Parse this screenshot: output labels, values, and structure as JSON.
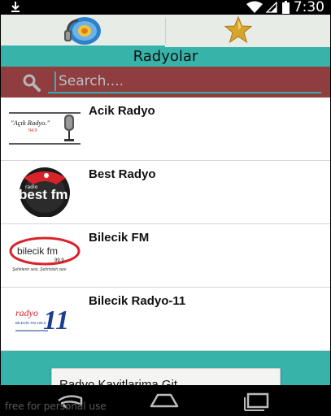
{
  "status_bar": {
    "time": "7:30"
  },
  "tabs": [
    {
      "icon": "radio-speaker-icon",
      "selected": true
    },
    {
      "icon": "star-icon",
      "selected": false
    }
  ],
  "title": "Radyolar",
  "search": {
    "placeholder": "Search....",
    "value": ""
  },
  "stations": [
    {
      "name": "Acik Radyo",
      "logo": "acik-radyo-logo",
      "logo_text": "\"Açık Radyo.\"",
      "logo_freq": "94.9"
    },
    {
      "name": "Best Radyo",
      "logo": "best-fm-logo",
      "logo_small": "radio",
      "logo_text": "best fm"
    },
    {
      "name": "Bilecik FM",
      "logo": "bilecik-fm-logo",
      "logo_text": "bilecik fm",
      "logo_freq": "99.9",
      "logo_slogan": "Şehirlerin sesi, Şehrinizin sesi"
    },
    {
      "name": "Bilecik Radyo-11",
      "logo": "bilecik-radyo-11-logo",
      "logo_text": "radyo",
      "logo_num": "11",
      "logo_sub": "BİLECİK FM 106.6"
    }
  ],
  "records_button": {
    "label": "Radyo Kayitlarima Git"
  },
  "watermark": "free for personal use",
  "colors": {
    "accent": "#37b3a9",
    "search_bg": "#8f3d3f",
    "tab_bg": "#e8ece7"
  }
}
